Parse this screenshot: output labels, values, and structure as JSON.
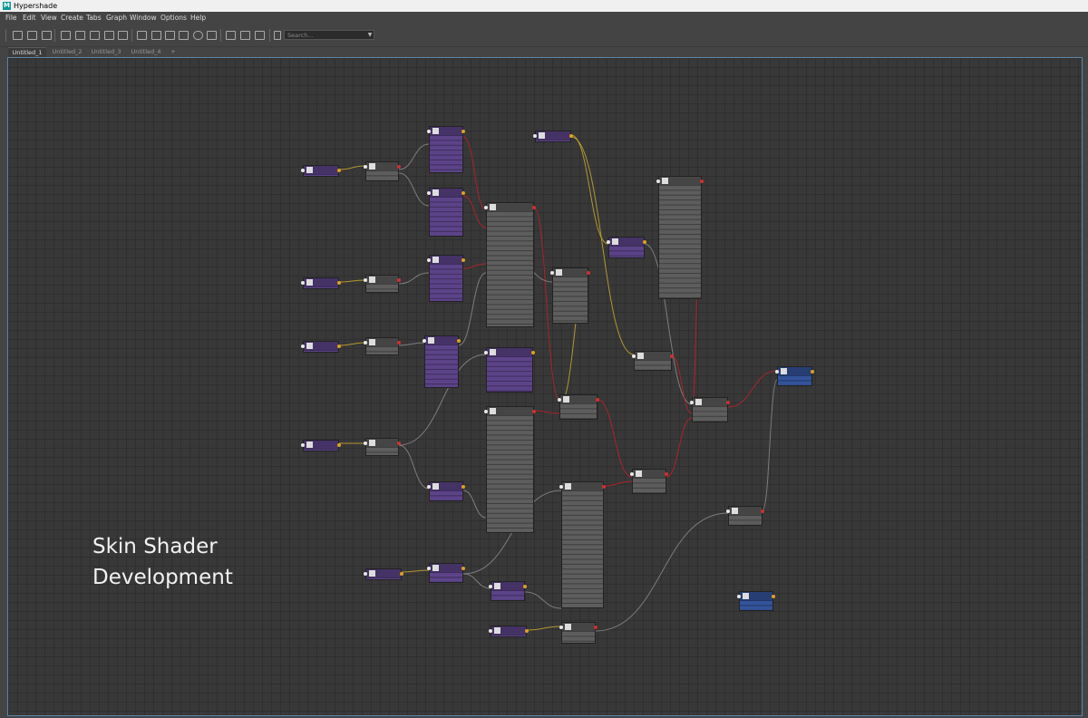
{
  "window": {
    "title": "Hypershade",
    "app_icon": "maya-icon"
  },
  "menu": [
    "File",
    "Edit",
    "View",
    "Create",
    "Tabs",
    "Graph",
    "Window",
    "Options",
    "Help"
  ],
  "toolbar": {
    "icons": [
      "frame-selection-icon",
      "frame-all-icon",
      "input-connections-icon",
      "output-connections-icon",
      "graph-inputs-icon",
      "graph-outputs-icon",
      "graph-up-downstream-icon",
      "clear-graph-icon",
      "remove-selected-icon",
      "simple-mode-icon",
      "connected-mode-icon",
      "full-mode-icon",
      "custom-mode-icon",
      "search-icon",
      "focus-icon",
      "grid-icon",
      "snap-icon",
      "lock-icon"
    ],
    "search_placeholder": "Search..."
  },
  "tabs": [
    {
      "label": "Untitled_1",
      "active": true
    },
    {
      "label": "Untitled_2",
      "active": false
    },
    {
      "label": "Untitled_3",
      "active": false
    },
    {
      "label": "Untitled_4",
      "active": false
    },
    {
      "label": "+",
      "active": false
    }
  ],
  "overlay_text": {
    "line1": "Skin Shader",
    "line2": "Development"
  },
  "colors": {
    "purple_node": "#5c4389",
    "grey_node": "#5d5d5d",
    "blue_node": "#33539a",
    "wire_red": "#c0202a",
    "wire_yellow": "#c8a830",
    "wire_grey": "#8a8a8a",
    "canvas_border": "#5a87ab"
  }
}
